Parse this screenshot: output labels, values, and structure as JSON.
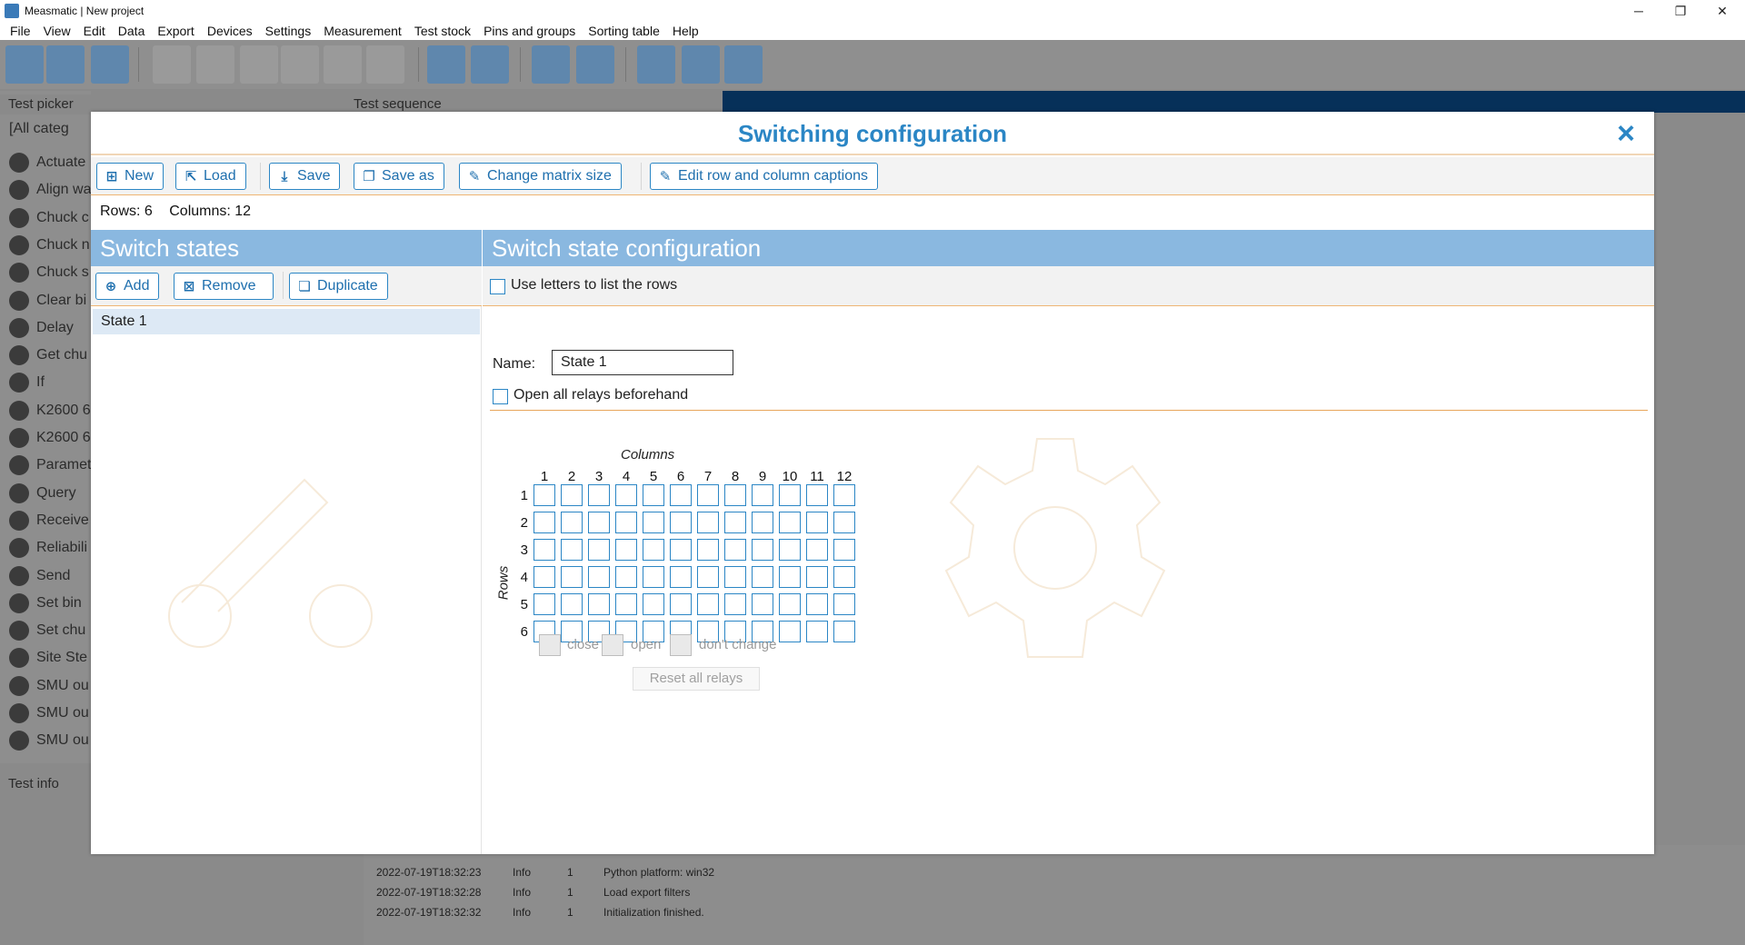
{
  "window": {
    "title": "Measmatic | New project",
    "min": "─",
    "max": "❐",
    "close": "✕"
  },
  "menu": [
    "File",
    "View",
    "Edit",
    "Data",
    "Export",
    "Devices",
    "Settings",
    "Measurement",
    "Test stock",
    "Pins and groups",
    "Sorting table",
    "Help"
  ],
  "background": {
    "test_picker": "Test picker",
    "category_filter": "[All categ",
    "test_sequence": "Test sequence",
    "test_info": "Test info",
    "picker_items": [
      "Actuate",
      "Align wa",
      "Chuck c",
      "Chuck n",
      "Chuck s",
      "Clear bi",
      "Delay",
      "Get chu",
      "If",
      "K2600 6",
      "K2600 6",
      "Paramet",
      "Query",
      "Receive",
      "Reliabili",
      "Send",
      "Set bin",
      "Set chu",
      "Site Ste",
      "SMU ou",
      "SMU ou",
      "SMU ou"
    ],
    "log": [
      {
        "time": "2022-07-19T18:32:23",
        "level": "Info",
        "n": "1",
        "msg": "Python platform: win32"
      },
      {
        "time": "2022-07-19T18:32:28",
        "level": "Info",
        "n": "1",
        "msg": "Load export filters"
      },
      {
        "time": "2022-07-19T18:32:32",
        "level": "Info",
        "n": "1",
        "msg": "Initialization finished."
      }
    ]
  },
  "dialog": {
    "title": "Switching configuration",
    "close_icon": "×",
    "toolbar": {
      "new": "New",
      "load": "Load",
      "save": "Save",
      "save_as": "Save as",
      "change_matrix_size": "Change matrix size",
      "edit_captions": "Edit row and column captions"
    },
    "rows_label": "Rows: 6",
    "columns_label": "Columns: 12",
    "switch_states": {
      "header": "Switch states",
      "add": "Add",
      "remove": "Remove",
      "duplicate": "Duplicate",
      "states": [
        "State 1"
      ]
    },
    "config": {
      "header": "Switch state configuration",
      "use_letters": "Use letters to list the rows",
      "name_label": "Name:",
      "name_value": "State 1",
      "open_all": "Open all relays beforehand",
      "columns_caption": "Columns",
      "rows_caption": "Rows",
      "column_numbers": [
        "1",
        "2",
        "3",
        "4",
        "5",
        "6",
        "7",
        "8",
        "9",
        "10",
        "11",
        "12"
      ],
      "row_numbers": [
        "1",
        "2",
        "3",
        "4",
        "5",
        "6"
      ],
      "legend": {
        "close": "close",
        "open": "open",
        "dont_change": "don't change"
      },
      "reset": "Reset all relays"
    }
  }
}
